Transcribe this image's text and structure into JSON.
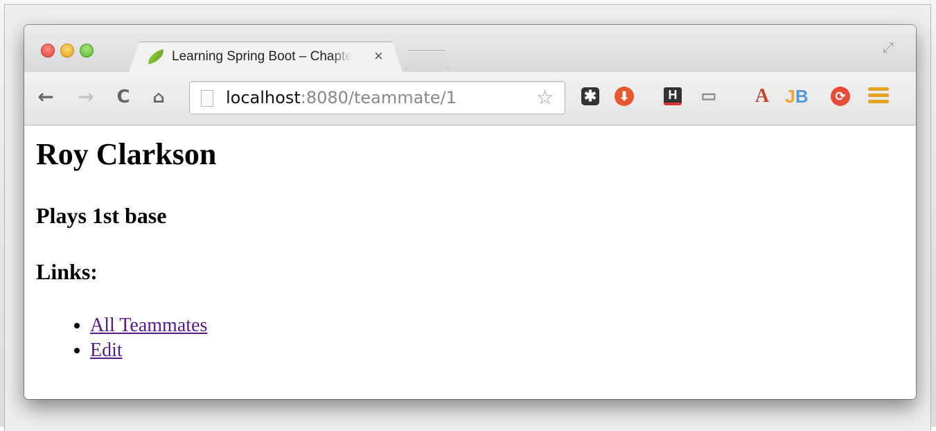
{
  "browser": {
    "tab": {
      "title": "Learning Spring Boot – Chapter",
      "close_label": "×"
    },
    "url": {
      "host": "localhost",
      "rest": ":8080/teammate/1"
    },
    "nav": {
      "back": "←",
      "forward": "→",
      "reload": "C",
      "home": "⌂"
    },
    "icons": {
      "fullscreen": "⤢",
      "star": "☆",
      "asterisk": "✱",
      "download": "⬇",
      "h_ext": "H",
      "cast": "▭",
      "acrobat": "A",
      "jb_j": "J",
      "jb_b": "B",
      "refresh": "⟳"
    }
  },
  "page": {
    "name": "Roy Clarkson",
    "position": "Plays 1st base",
    "links_heading": "Links:",
    "links": [
      {
        "label": "All Teammates"
      },
      {
        "label": "Edit"
      }
    ]
  }
}
